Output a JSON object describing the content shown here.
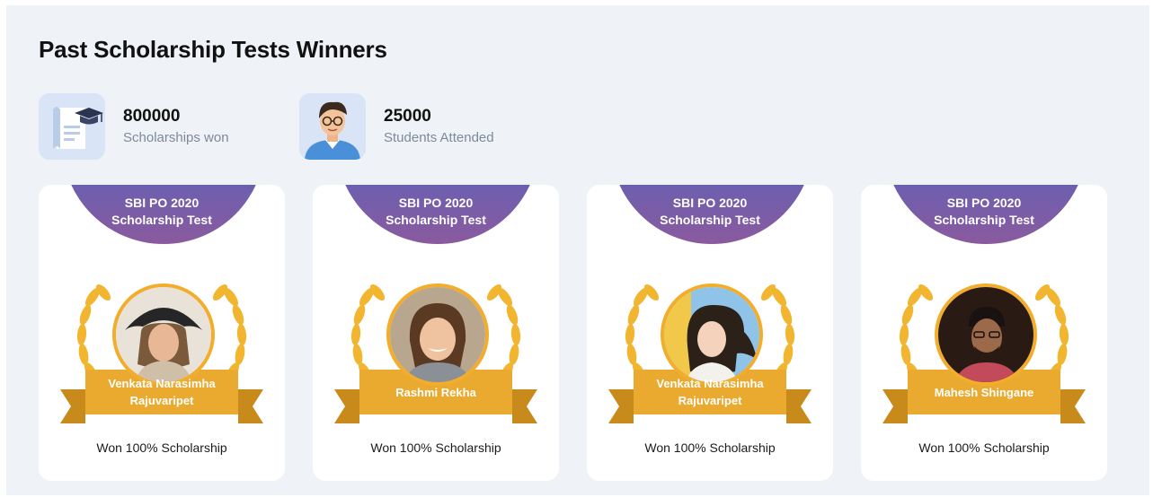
{
  "page": {
    "title": "Past Scholarship Tests Winners"
  },
  "stats": [
    {
      "value": "800000",
      "label": "Scholarships won",
      "icon": "scholarship-certificate-icon"
    },
    {
      "value": "25000",
      "label": "Students Attended",
      "icon": "student-avatar-icon"
    }
  ],
  "winners": [
    {
      "test_line1": "SBI PO 2020",
      "test_line2": "Scholarship Test",
      "name_line1": "Venkata Narasimha",
      "name_line2": "Rajuvaripet",
      "result": "Won 100% Scholarship"
    },
    {
      "test_line1": "SBI PO 2020",
      "test_line2": "Scholarship Test",
      "name_line1": "Rashmi Rekha",
      "name_line2": "",
      "result": "Won 100% Scholarship"
    },
    {
      "test_line1": "SBI PO 2020",
      "test_line2": "Scholarship Test",
      "name_line1": "Venkata Narasimha",
      "name_line2": "Rajuvaripet",
      "result": "Won 100% Scholarship"
    },
    {
      "test_line1": "SBI PO 2020",
      "test_line2": "Scholarship Test",
      "name_line1": "Mahesh Shingane",
      "name_line2": "",
      "result": "Won 100% Scholarship"
    }
  ],
  "colors": {
    "panel_bg": "#eff2f6",
    "ribbon": "#eaa92f",
    "ribbon_dark": "#c98a1c",
    "laurel": "#f2b52f",
    "arc_top": "#5d62b8",
    "arc_bottom": "#8a5a9e"
  }
}
